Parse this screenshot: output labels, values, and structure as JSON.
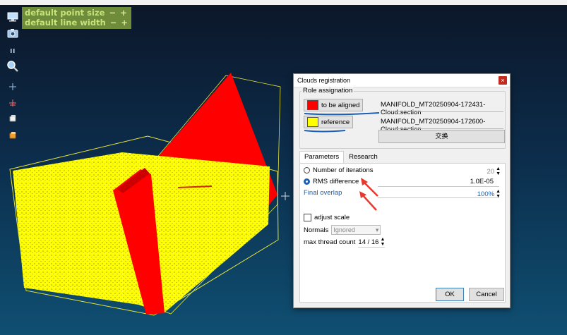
{
  "overlay": {
    "point_size_label": "default point size",
    "line_width_label": "default line width",
    "minus": "−",
    "plus": "+"
  },
  "toolbar": {
    "icons": [
      "display-icon",
      "camera-icon",
      "pause-icon",
      "zoom-icon",
      "crosshair-icon",
      "cross-red-icon",
      "cube-white-icon",
      "cube-orange-icon"
    ]
  },
  "dialog": {
    "title": "Clouds registration",
    "close_symbol": "×",
    "role_group_title": "Role assignation",
    "roles": [
      {
        "label": "to be aligned",
        "color": "#ff0000",
        "cloud": "MANIFOLD_MT20250904-172431-Cloud.section"
      },
      {
        "label": "reference",
        "color": "#ffff00",
        "cloud": "MANIFOLD_MT20250904-172600-Cloud.section"
      }
    ],
    "swap_label": "交换",
    "tabs": [
      "Parameters",
      "Research"
    ],
    "params": {
      "iterations_label": "Number of iterations",
      "iterations_value": "20",
      "rms_label": "RMS difference",
      "rms_value": "1.0E-05",
      "overlap_label": "Final overlap",
      "overlap_value": "100%",
      "adjust_scale_label": "adjust scale",
      "normals_label": "Normals",
      "normals_value": "Ignored",
      "thread_label": "max thread count",
      "thread_value": "14 / 16"
    },
    "ok_label": "OK",
    "cancel_label": "Cancel"
  },
  "colors": {
    "accent_blue": "#1a5fb4",
    "annotation_red": "#e8392f",
    "aligned_cloud": "#ff0000",
    "reference_cloud": "#ffff00"
  }
}
